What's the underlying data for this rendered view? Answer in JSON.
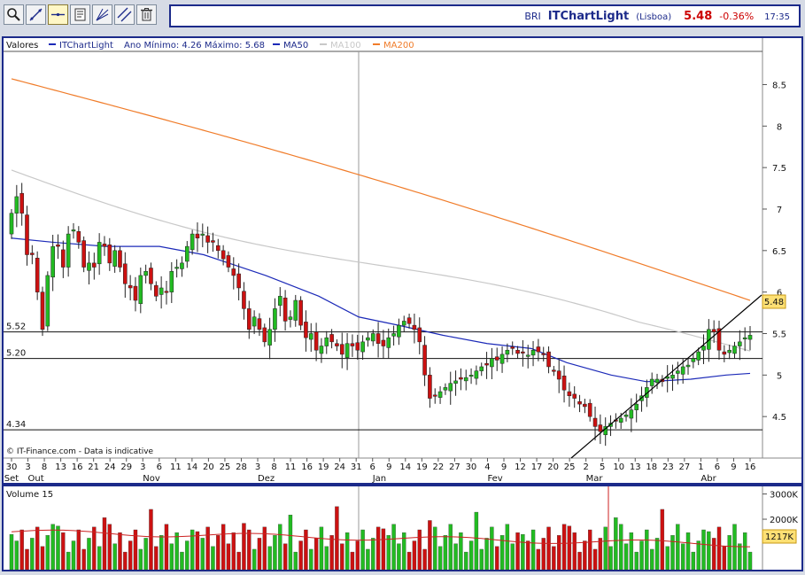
{
  "toolbar": {
    "buttons": [
      {
        "name": "zoom-tool-button",
        "icon": "magnifier-icon",
        "active": false
      },
      {
        "name": "trendline-tool-button",
        "icon": "diagonal-line-icon",
        "active": false
      },
      {
        "name": "horizontal-line-tool-button",
        "icon": "horizontal-line-icon",
        "active": true
      },
      {
        "name": "text-tool-button",
        "icon": "text-note-icon",
        "active": false
      },
      {
        "name": "fibonacci-tool-button",
        "icon": "fan-lines-icon",
        "active": false
      },
      {
        "name": "channel-tool-button",
        "icon": "parallel-lines-icon",
        "active": false
      },
      {
        "name": "delete-drawings-button",
        "icon": "trash-icon",
        "active": false
      }
    ]
  },
  "quote": {
    "code": "BRI",
    "name": "ITChartLight",
    "market": "(Lisboa)",
    "price": "5.48",
    "change": "-0.36%",
    "time": "17:35"
  },
  "legend": {
    "label": "Valores",
    "series_name": "ITChartLight",
    "range_text": "Ano Mínimo: 4.26 Máximo: 5.68",
    "ma": [
      {
        "label": "MA50",
        "color": "#1c2ab8"
      },
      {
        "label": "MA100",
        "color": "#c8c8c8"
      },
      {
        "label": "MA200",
        "color": "#f07c2a"
      }
    ]
  },
  "levels": [
    "5.52",
    "5.20",
    "4.34"
  ],
  "last_price_tag": "5.48",
  "watermark": "© IT-Finance.com - Data is indicative",
  "volume": {
    "label": "Volume 15",
    "axis_ticks": [
      "3000K",
      "2000K"
    ],
    "last_tag": "1217K"
  },
  "colors": {
    "up": "#22bb22",
    "down": "#cc1111",
    "frame": "#1c2a8a",
    "volume_ma": "#cc2222"
  },
  "chart_data": {
    "type": "candlestick",
    "y_ticks": [
      "8.5",
      "8",
      "7.5",
      "7",
      "6.5",
      "6",
      "5.5",
      "5",
      "4.5"
    ],
    "ylim": [
      4.0,
      8.9
    ],
    "x_day_labels": [
      "30",
      "3",
      "8",
      "13",
      "16",
      "21",
      "24",
      "29",
      "3",
      "6",
      "11",
      "14",
      "20",
      "25",
      "28",
      "3",
      "8",
      "11",
      "16",
      "19",
      "24",
      "31",
      "6",
      "9",
      "14",
      "19",
      "22",
      "27",
      "30",
      "4",
      "9",
      "12",
      "17",
      "20",
      "25",
      "2",
      "5",
      "10",
      "13",
      "18",
      "23",
      "27",
      "1",
      "6",
      "9",
      "16"
    ],
    "x_month_labels": [
      "Set",
      "Out",
      "Nov",
      "Dez",
      "Jan",
      "Fev",
      "Mar",
      "Abr"
    ],
    "close": [
      6.95,
      7.15,
      6.95,
      6.45,
      6.45,
      6.0,
      5.55,
      6.2,
      6.55,
      6.55,
      6.3,
      6.7,
      6.75,
      6.6,
      6.3,
      6.35,
      6.3,
      6.6,
      6.55,
      6.35,
      6.5,
      6.3,
      6.1,
      6.05,
      5.9,
      6.2,
      6.25,
      6.1,
      5.95,
      6.05,
      6.0,
      6.25,
      6.3,
      6.35,
      6.55,
      6.7,
      6.65,
      6.7,
      6.6,
      6.6,
      6.5,
      6.4,
      6.3,
      6.2,
      6.05,
      5.8,
      5.55,
      5.7,
      5.55,
      5.4,
      5.55,
      5.8,
      5.95,
      5.65,
      5.7,
      5.9,
      5.6,
      5.45,
      5.5,
      5.3,
      5.35,
      5.45,
      5.4,
      5.35,
      5.25,
      5.38,
      5.35,
      5.3,
      5.4,
      5.45,
      5.5,
      5.38,
      5.35,
      5.45,
      5.5,
      5.6,
      5.65,
      5.62,
      5.55,
      5.4,
      5.0,
      4.72,
      4.75,
      4.8,
      4.85,
      4.9,
      4.93,
      4.95,
      4.97,
      5.0,
      5.05,
      5.1,
      5.12,
      5.2,
      5.18,
      5.25,
      5.3,
      5.32,
      5.26,
      5.27,
      5.24,
      5.3,
      5.28,
      5.26,
      5.1,
      5.05,
      4.95,
      4.82,
      4.75,
      4.72,
      4.65,
      4.62,
      4.5,
      4.38,
      4.32,
      4.38,
      4.42,
      4.45,
      4.48,
      4.52,
      4.58,
      4.65,
      4.75,
      4.85,
      4.95,
      4.95,
      4.92,
      4.98,
      5.0,
      5.05,
      5.1,
      5.12,
      5.2,
      5.28,
      5.35,
      5.55,
      5.52,
      5.3,
      5.25,
      5.3,
      5.35,
      5.4,
      5.45,
      5.48
    ]
  }
}
